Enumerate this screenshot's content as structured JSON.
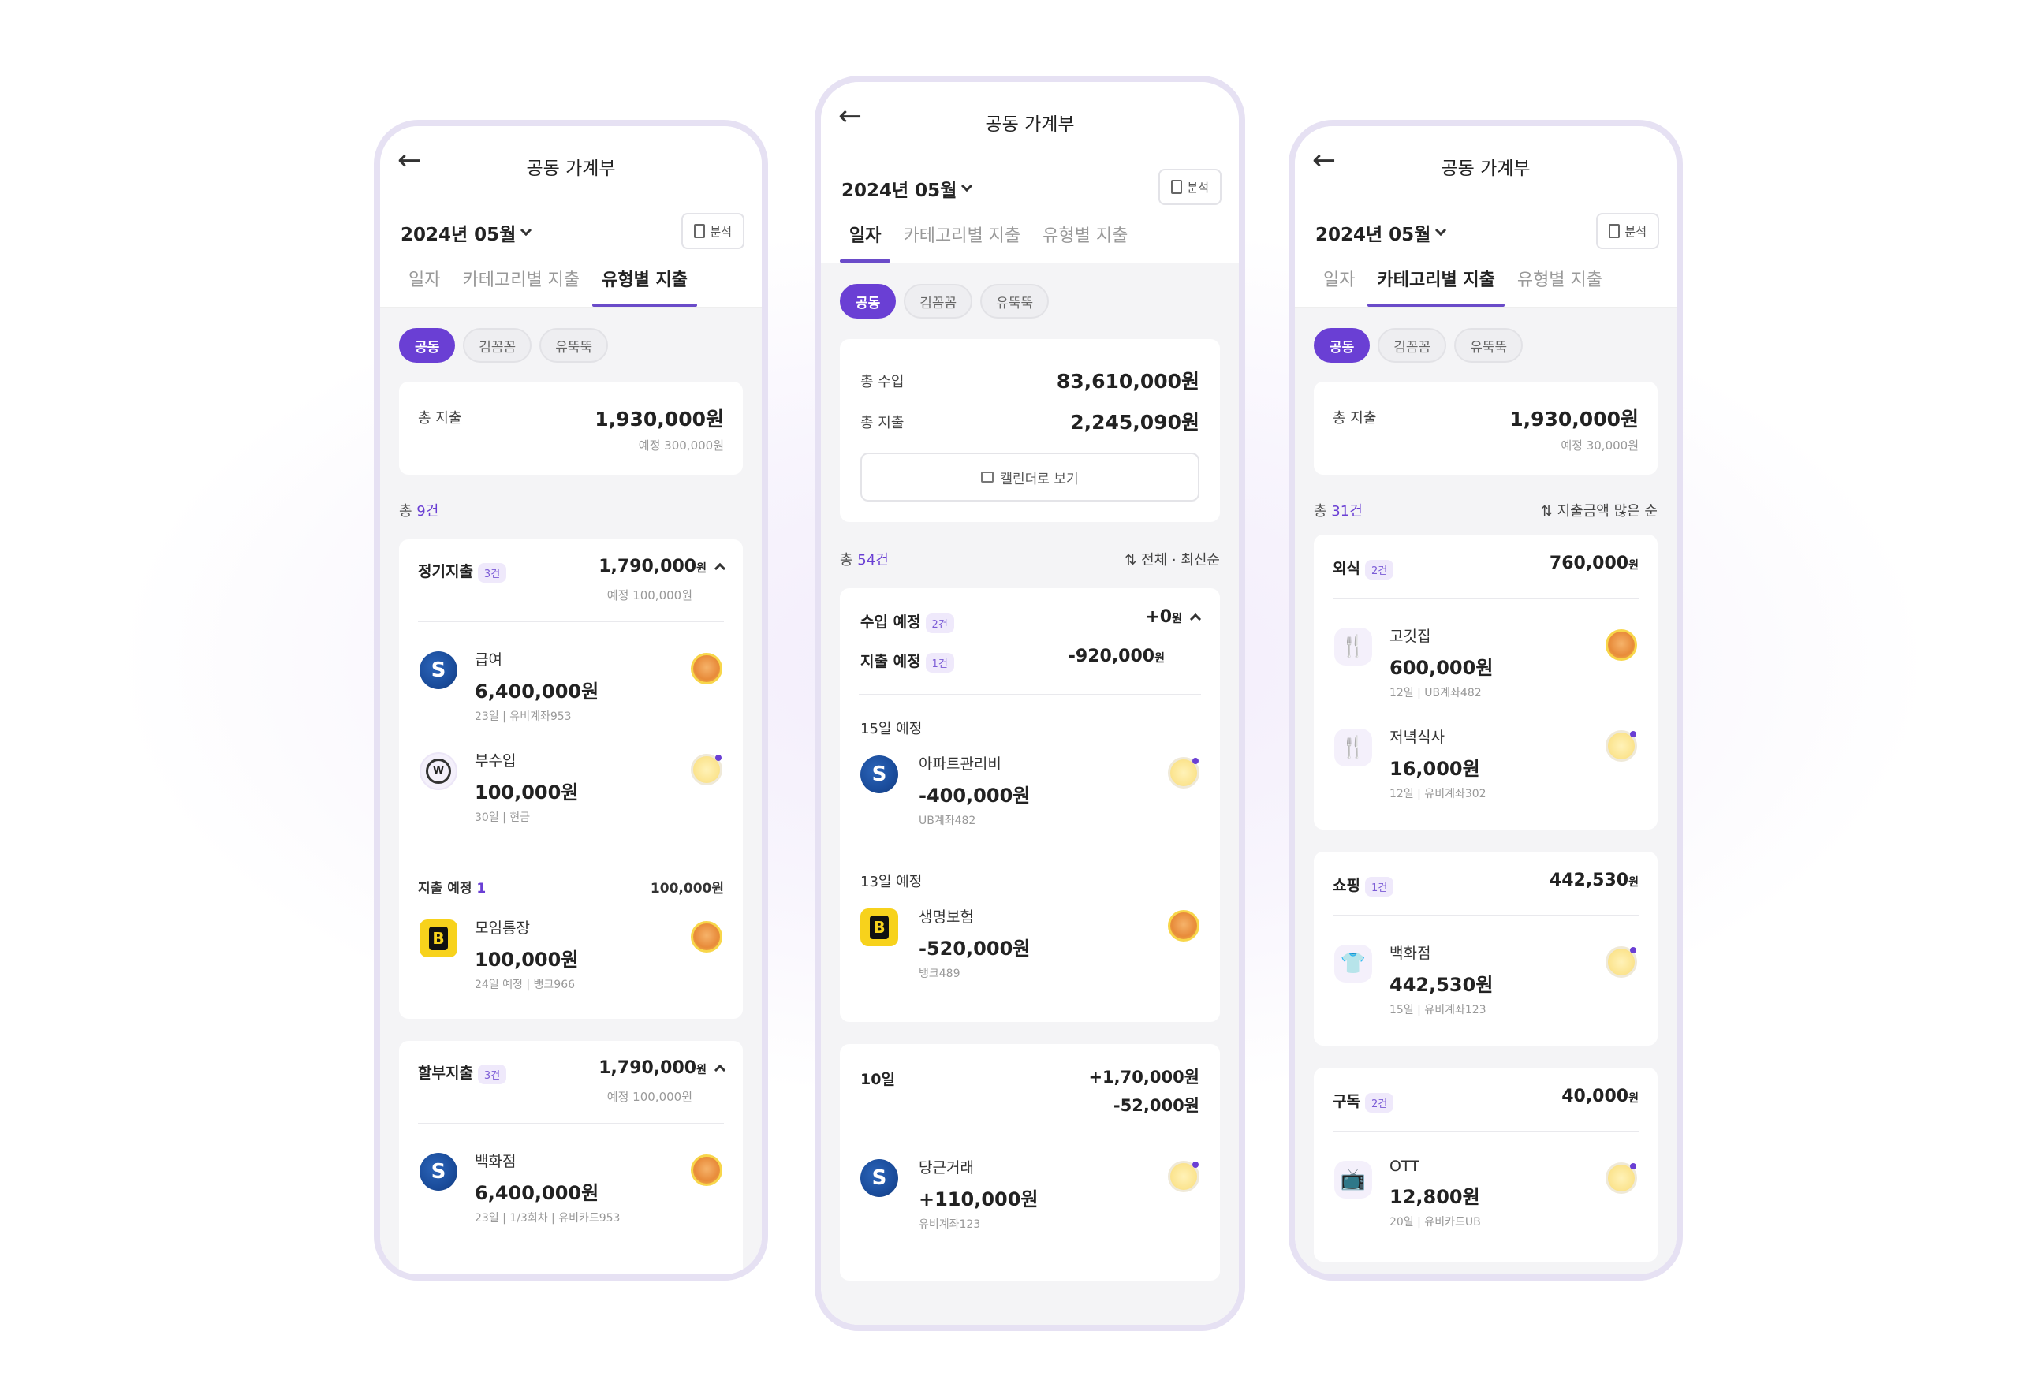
{
  "common": {
    "title": "공동 가계부",
    "month": "2024년 05월",
    "analysis": "분석"
  },
  "tabs": [
    "일자",
    "카테고리별 지출",
    "유형별 지출"
  ],
  "chips": [
    "공동",
    "김꼼꼼",
    "유뚝뚝"
  ],
  "left": {
    "summary": {
      "label": "총 지출",
      "amount": "1,930,000원",
      "planned": "예정 300,000원"
    },
    "count_prefix": "총 ",
    "count": "9건",
    "groups": [
      {
        "title": "정기지출",
        "badge": "3건",
        "amount": "1,790,000",
        "unit": "원",
        "planned": "예정 100,000원",
        "items": [
          {
            "name": "급여",
            "amount": "6,400,000원",
            "meta": "23일 | 유비계좌953"
          },
          {
            "name": "부수입",
            "amount": "100,000원",
            "meta": "30일 | 현금"
          }
        ],
        "sched": {
          "label": "지출 예정 ",
          "count": "1",
          "amount": "100,000원",
          "item": {
            "name": "모임통장",
            "amount": "100,000원",
            "meta": "24일 예정 | 뱅크966"
          }
        }
      },
      {
        "title": "할부지출",
        "badge": "3건",
        "amount": "1,790,000",
        "unit": "원",
        "planned": "예정 100,000원",
        "items": [
          {
            "name": "백화점",
            "amount": "6,400,000원",
            "meta": "23일 | 1/3회차 | 유비카드953"
          }
        ]
      }
    ]
  },
  "center": {
    "summary": {
      "income_label": "총 수입",
      "income": "83,610,000원",
      "expense_label": "총 지출",
      "expense": "2,245,090원",
      "calendar": "캘린더로 보기"
    },
    "count_prefix": "총 ",
    "count": "54건",
    "sort": "전체 · 최신순",
    "planned": {
      "income_label": "수입 예정",
      "income_badge": "2건",
      "income_amount": "+0",
      "expense_label": "지출 예정",
      "expense_badge": "1건",
      "expense_amount": "-920,000",
      "unit": "원"
    },
    "days": [
      {
        "label": "15일 예정",
        "item": {
          "name": "아파트관리비",
          "amount": "-400,000원",
          "meta": "UB계좌482"
        }
      },
      {
        "label": "13일 예정",
        "item": {
          "name": "생명보험",
          "amount": "-520,000원",
          "meta": "뱅크489"
        }
      }
    ],
    "day10": {
      "label": "10일",
      "plus": "+1,70,000원",
      "minus": "-52,000원",
      "item": {
        "name": "당근거래",
        "amount": "+110,000원",
        "meta": "유비계좌123"
      }
    }
  },
  "right": {
    "summary": {
      "label": "총 지출",
      "amount": "1,930,000원",
      "planned": "예정 30,000원"
    },
    "count_prefix": "총 ",
    "count": "31건",
    "sort": "지출금액 많은 순",
    "groups": [
      {
        "title": "외식",
        "badge": "2건",
        "amount": "760,000",
        "unit": "원",
        "items": [
          {
            "name": "고깃집",
            "amount": "600,000원",
            "meta": "12일 | UB계좌482"
          },
          {
            "name": "저녁식사",
            "amount": "16,000원",
            "meta": "12일 | 유비계좌302"
          }
        ]
      },
      {
        "title": "쇼핑",
        "badge": "1건",
        "amount": "442,530",
        "unit": "원",
        "items": [
          {
            "name": "백화점",
            "amount": "442,530원",
            "meta": "15일 | 유비계좌123"
          }
        ]
      },
      {
        "title": "구독",
        "badge": "2건",
        "amount": "40,000",
        "unit": "원",
        "items": [
          {
            "name": "OTT",
            "amount": "12,800원",
            "meta": "20일 | 유비카드UB"
          }
        ]
      }
    ]
  }
}
